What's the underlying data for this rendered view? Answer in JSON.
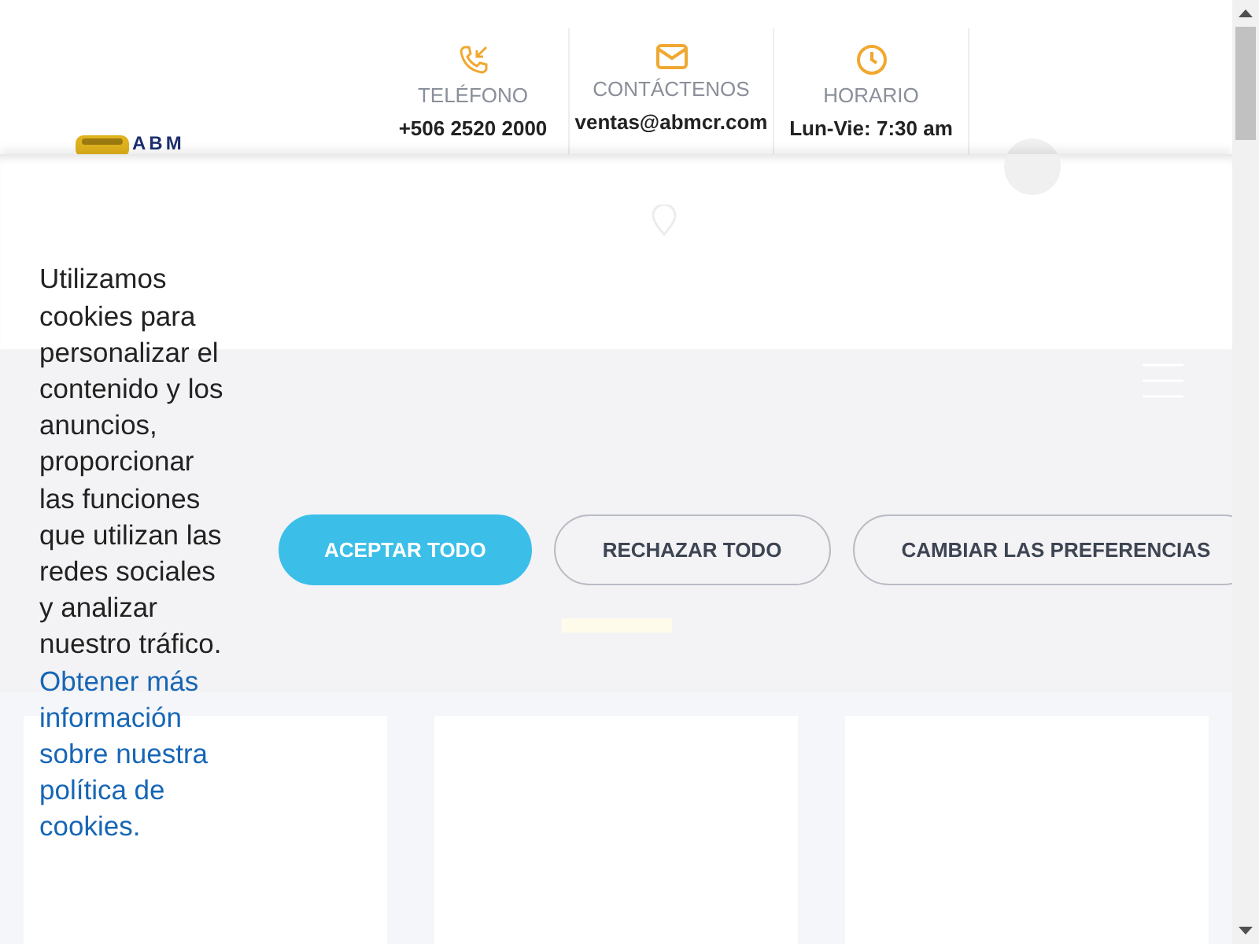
{
  "header": {
    "logo_text": "ABM",
    "contact_items": [
      {
        "kind": "phone",
        "label": "TELÉFONO",
        "value": "+506 2520 2000"
      },
      {
        "kind": "email",
        "label": "CONTÁCTENOS",
        "value": "ventas@abmcr.com"
      },
      {
        "kind": "clock",
        "label": "HORARIO",
        "value": "Lun-Vie: 7:30 am"
      }
    ]
  },
  "cookie_banner": {
    "message": "Utilizamos cookies para personalizar el contenido y los anuncios, proporcionar las funciones que utilizan las redes sociales y analizar nuestro tráfico.",
    "link": "Obtener más información sobre nuestra política de cookies.",
    "buttons": [
      {
        "label": "ACEPTAR TODO",
        "kind": "primary"
      },
      {
        "label": "RECHAZAR TODO",
        "kind": "outline"
      },
      {
        "label": "CAMBIAR LAS PREFERENCIAS",
        "kind": "outline"
      }
    ]
  }
}
